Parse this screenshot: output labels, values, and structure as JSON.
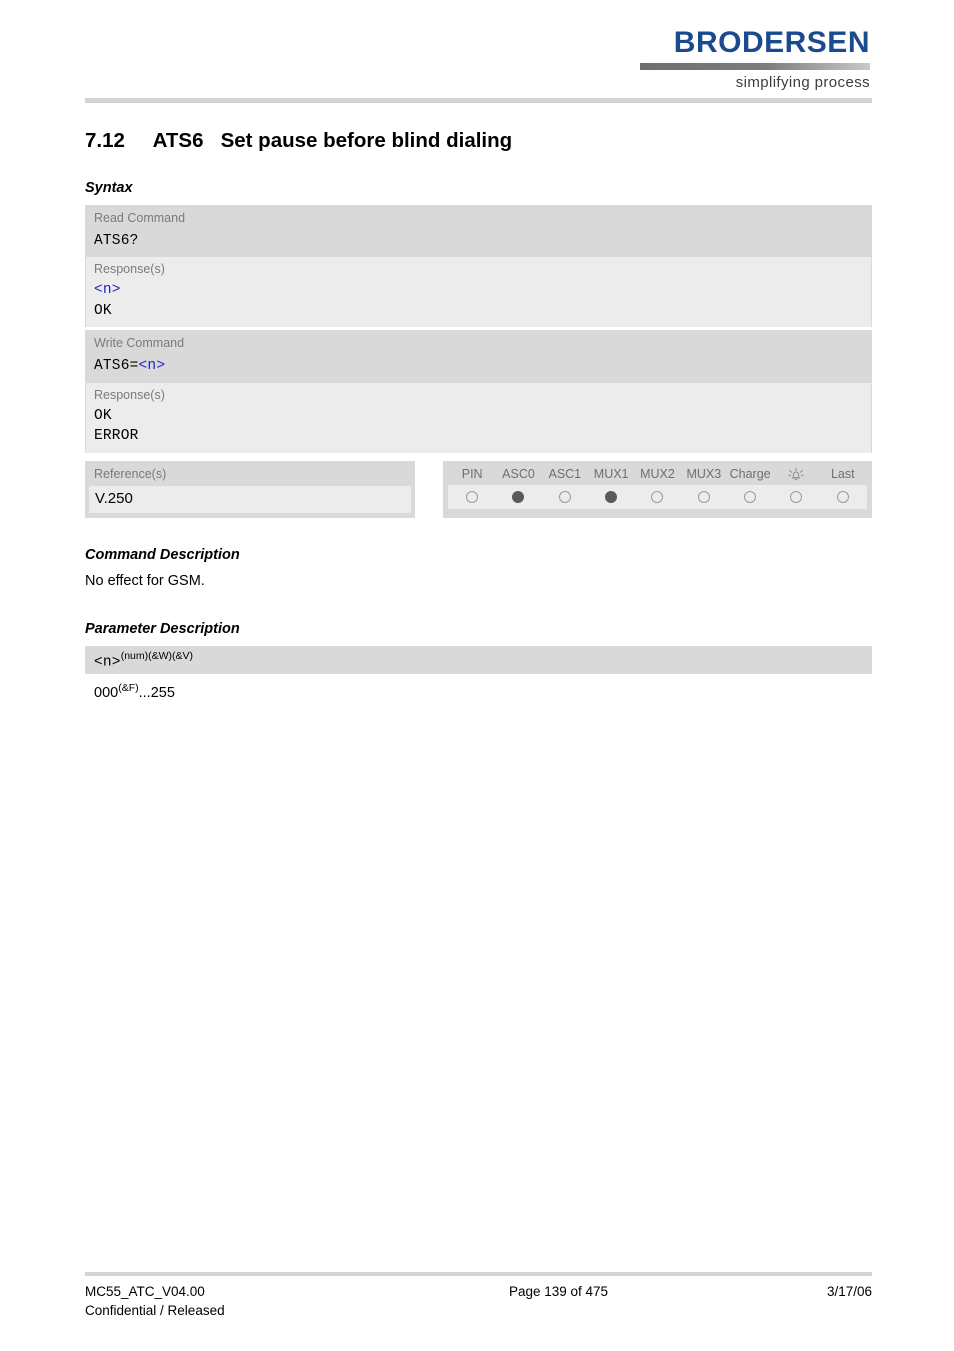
{
  "header": {
    "logo_wordmark": "BRODERSEN",
    "logo_tagline": "simplifying process"
  },
  "section": {
    "number": "7.12",
    "command": "ATS6",
    "title": "Set pause before blind dialing",
    "heading_full": "7.12     ATS6   Set pause before blind dialing"
  },
  "headings": {
    "syntax": "Syntax",
    "command_description": "Command Description",
    "parameter_description": "Parameter Description"
  },
  "syntax": {
    "read": {
      "label": "Read Command",
      "command": "ATS6?",
      "response_label": "Response(s)",
      "response_param": "<n>",
      "response_ok": "OK"
    },
    "write": {
      "label": "Write Command",
      "command_prefix": "ATS6=",
      "command_param": "<n>",
      "response_label": "Response(s)",
      "response_ok": "OK",
      "response_error": "ERROR"
    }
  },
  "reference": {
    "label": "Reference(s)",
    "value": "V.250"
  },
  "properties": {
    "columns": [
      {
        "label": "PIN",
        "state": false
      },
      {
        "label": "ASC0",
        "state": true
      },
      {
        "label": "ASC1",
        "state": false
      },
      {
        "label": "MUX1",
        "state": true
      },
      {
        "label": "MUX2",
        "state": false
      },
      {
        "label": "MUX3",
        "state": false
      },
      {
        "label": "Charge",
        "state": false
      },
      {
        "label": "alarm-icon",
        "state": false
      },
      {
        "label": "Last",
        "state": false
      }
    ],
    "labels": {
      "pin": "PIN",
      "asc0": "ASC0",
      "asc1": "ASC1",
      "mux1": "MUX1",
      "mux2": "MUX2",
      "mux3": "MUX3",
      "charge": "Charge",
      "alarm": "",
      "last": "Last"
    }
  },
  "command_description": {
    "text": "No effect for GSM."
  },
  "parameter": {
    "name": "<n>",
    "name_superscript": "(num)(&W)(&V)",
    "value_base": "000",
    "value_superscript": "(&F)",
    "value_rest": "...255"
  },
  "footer": {
    "document": "MC55_ATC_V04.00",
    "classification": "Confidential / Released",
    "page": "Page 139 of 475",
    "date": "3/17/06"
  },
  "colors": {
    "brand_blue": "#1b4b8f",
    "param_blue": "#2222cc",
    "panel_gray": "#d9d9d9",
    "inner_gray": "#ececec",
    "dot_on": "#5a5a5a"
  }
}
